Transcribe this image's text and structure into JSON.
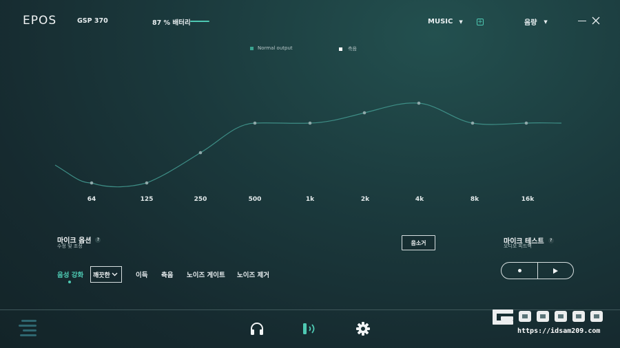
{
  "header": {
    "logo": "EPOS",
    "device": "GSP 370",
    "battery": "87 % 배터리",
    "preset": "MUSIC",
    "volume": "음량"
  },
  "legend": {
    "normal_output": "Normal output",
    "measure": "측음"
  },
  "eq": {
    "frequencies": [
      "64",
      "125",
      "250",
      "500",
      "1k",
      "2k",
      "4k",
      "8k",
      "16k"
    ]
  },
  "mic": {
    "title": "마이크 옵션",
    "subtitle": "수정 및 조정",
    "help": "?",
    "mute_button": "음소거",
    "tabs": [
      "음성 강화",
      "이득",
      "측음",
      "노이즈 게이트",
      "노이즈 제거"
    ],
    "dropdown_value": "깨끗한",
    "test_title": "마이크 테스트",
    "test_subtitle": "오디오 피드백",
    "test_help": "?"
  },
  "watermark": {
    "url": "https://idsam209.com"
  },
  "colors": {
    "accent": "#4ec9b3",
    "background": "#1b3a3d"
  }
}
